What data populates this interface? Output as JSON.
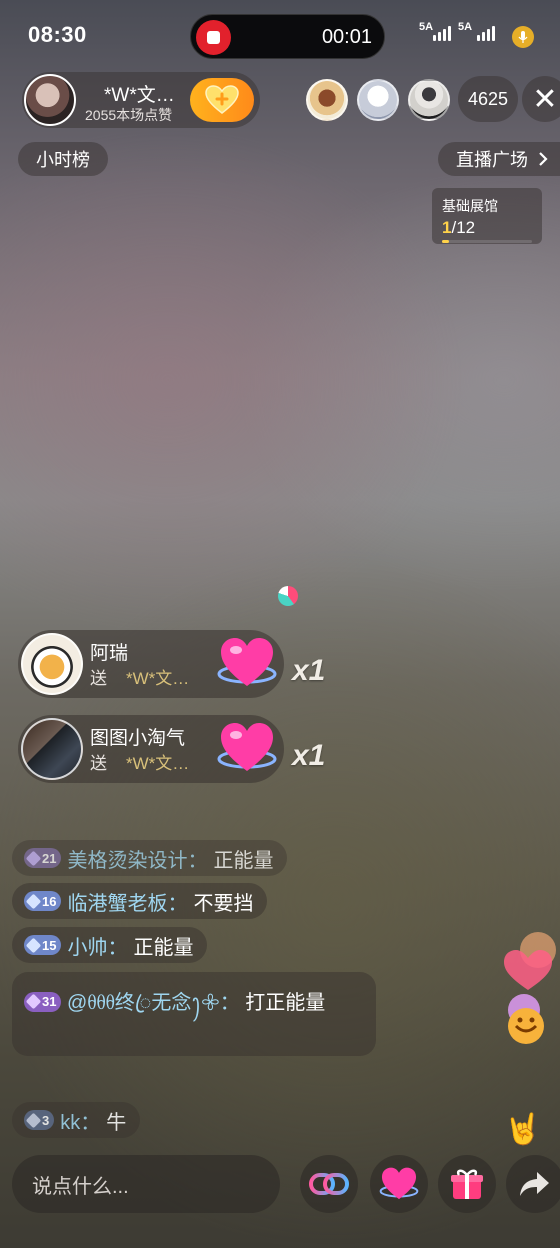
{
  "status_bar": {
    "time": "08:30",
    "recording_time": "00:01",
    "network1": "5A",
    "network2": "5A"
  },
  "host": {
    "name": "*W*文…",
    "likes": "2055本场点赞"
  },
  "viewer_count": "4625",
  "top_left_button": "小时榜",
  "top_right_button": "直播广场",
  "exhibit": {
    "title": "基础展馆",
    "current": "1",
    "total": "/12",
    "progress": 0.083
  },
  "gifts": [
    {
      "sender": "阿瑞",
      "send_label": "送",
      "recipient": "*W*文…",
      "count": "x1"
    },
    {
      "sender": "图图小淘气",
      "send_label": "送",
      "recipient": "*W*文…",
      "count": "x1"
    }
  ],
  "chat": [
    {
      "level": "21",
      "user": "美格烫染设计",
      "sep": "：",
      "text": "正能量",
      "color": "#7b6a9e"
    },
    {
      "level": "16",
      "user": "临港蟹老板",
      "sep": "：",
      "text": "不要挡",
      "color": "#6f87c9"
    },
    {
      "level": "15",
      "user": "小帅",
      "sep": "：",
      "text": "正能量",
      "color": "#6f87c9"
    },
    {
      "level": "31",
      "user": "@ᦲᦲᦲ终ꦿ无念ꫂ𖧷",
      "sep": "：",
      "text": "打正能量",
      "color": "#8a5fc0"
    },
    {
      "level": "3",
      "user": "kk",
      "sep": "：",
      "text": "牛",
      "color": "#5b6a88"
    }
  ],
  "input_placeholder": "说点什么...",
  "colors": {
    "record_red": "#e2212c",
    "follow_orange": "#ffa21c",
    "username_blue": "#9fd6f0",
    "gold": "#d8c07a"
  }
}
